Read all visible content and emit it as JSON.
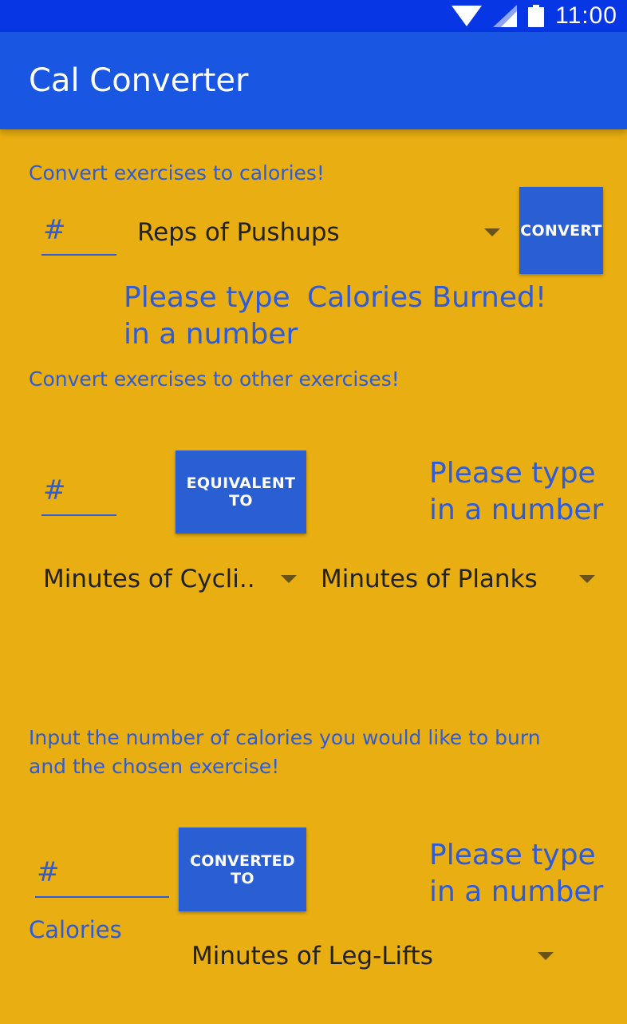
{
  "status_bar": {
    "time": "11:00",
    "icons": [
      "wifi-icon",
      "signal-icon",
      "battery-icon"
    ]
  },
  "app_bar": {
    "title": "Cal Converter"
  },
  "section1": {
    "label": "Convert exercises to calories!",
    "input_placeholder": "#",
    "exercise_selected": "Reps of Pushups",
    "button": "CONVERT",
    "result_line1": "Please type",
    "result_line2": "in a number",
    "result_label": "Calories Burned!"
  },
  "section2": {
    "label": "Convert exercises to other exercises!",
    "input_placeholder": "#",
    "button": "EQUIVALENT TO",
    "result_line1": "Please type",
    "result_line2": "in a number",
    "from_exercise": "Minutes of Cycli..",
    "to_exercise": "Minutes of Planks"
  },
  "section3": {
    "label_line1": "Input the number of calories you would like to burn",
    "label_line2": "and the chosen exercise!",
    "input_placeholder": "#",
    "input_unit": "Calories",
    "button": "CONVERTED TO",
    "result_line1": "Please type",
    "result_line2": "in a number",
    "exercise_selected": "Minutes of Leg-Lifts"
  },
  "colors": {
    "background": "#E9AE11",
    "status_bar": "#0737E5",
    "app_bar": "#1957E3",
    "accent_text": "#2F5BD6",
    "button": "#2A5FD4"
  }
}
